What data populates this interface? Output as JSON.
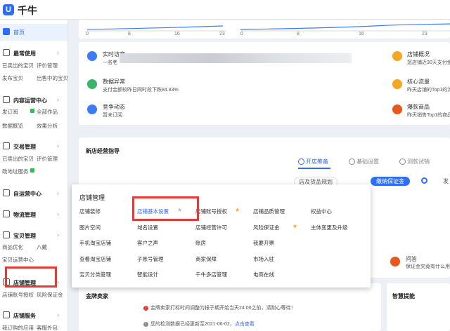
{
  "header": {
    "logo_glyph": "U",
    "brand": "千牛"
  },
  "sidebar": {
    "home": "首页",
    "sections": [
      {
        "title": "最常使用",
        "items": [
          "已卖出的宝贝",
          "评价管理",
          "发布宝贝",
          "出售中的宝贝"
        ]
      },
      {
        "title": "内容运营中心",
        "items": [
          "发订阅",
          "全部作品",
          "数据概览",
          "效果分析"
        ]
      },
      {
        "title": "交易管理",
        "items": [
          "已卖出的宝贝",
          "评价管理",
          "政地址服务"
        ]
      },
      {
        "title": "自运营中心"
      },
      {
        "title": "物流管理"
      },
      {
        "title": "宝贝管理",
        "items": [
          "商品优化",
          "八戴",
          "宝贝运营中心"
        ]
      },
      {
        "title": "店铺管理",
        "items": [
          "店铺账号授权",
          "风险保证金"
        ]
      },
      {
        "title": "店铺服务",
        "items": [
          "我订购的应用",
          "客服外包"
        ]
      }
    ]
  },
  "charts": {
    "left_ticks": [
      "0",
      "8",
      "16",
      "23"
    ],
    "right_ticks": [
      "0",
      "8",
      "16",
      "23"
    ]
  },
  "stats_left": [
    {
      "title": "实时访客",
      "sub": "一名老",
      "color": "#3b7cf6"
    },
    {
      "title": "数据异常",
      "sub": "支付金额较昨日同时段下跌84.83%",
      "color": "#3ab36b"
    },
    {
      "title": "竞争动态",
      "sub": "暂未订阅",
      "color": "#3b7cf6"
    }
  ],
  "stats_right": [
    {
      "title": "店铺概况",
      "sub": "您店铺近30天支付金",
      "color": "#f5a623"
    },
    {
      "title": "核心流量",
      "sub": "昨天店铺的Top1的流",
      "color": "#f5a623"
    },
    {
      "title": "爆款商品",
      "sub": "昨天销售Top1的商品",
      "color": "#e8571e"
    }
  ],
  "guide": {
    "title": "新店经营指导",
    "tabs": [
      "开店筹备",
      "基础设置",
      "测款试销"
    ],
    "steps": [
      "店及货品规划",
      "缴纳保证金",
      "发"
    ]
  },
  "popup": {
    "title": "店铺管理",
    "columns": [
      [
        "店铺装修",
        "图片空间",
        "手机淘宝店铺",
        "查看淘宝店铺",
        "宝贝分类管理"
      ],
      [
        "店铺基本设置",
        "域名设置",
        "客户之声",
        "子账号管理",
        "智能设计"
      ],
      [
        "店铺账号授权",
        "店铺经营许可",
        "账房",
        "商家保障",
        "千牛多店管理"
      ],
      [
        "店铺品质管理",
        "风险保证金",
        "我要开票",
        "市场入驻",
        "电商在线"
      ],
      [
        "权益中心",
        "主体变更及升级"
      ]
    ]
  },
  "right_card": {
    "title": "问答",
    "sub": "保证金究竟有什么用"
  },
  "gold_seller": {
    "title": "金牌卖家",
    "tip1": "金牌卖家打标时间调整为报子期开始当天24:00之前，请耐心等待！",
    "tip2_prefix": "您的检测数据已经更新至2021-06-02，",
    "tip2_link": "点击查看"
  },
  "smart": {
    "title": "智慧提能"
  }
}
